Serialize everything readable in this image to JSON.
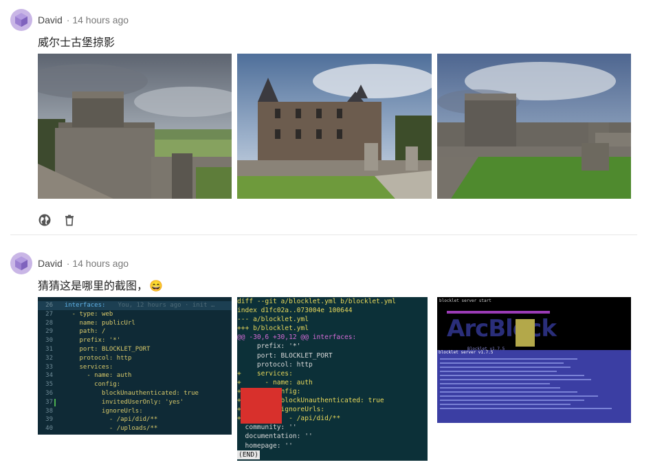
{
  "posts": [
    {
      "author": "David",
      "time": "· 14 hours ago",
      "text": "威尔士古堡掠影",
      "images": [
        {
          "alt": "castle-tower-photo"
        },
        {
          "alt": "chateau-photo"
        },
        {
          "alt": "castle-ruins-photo"
        }
      ],
      "actions": [
        {
          "icon": "globe-icon"
        },
        {
          "icon": "trash-icon"
        }
      ]
    },
    {
      "author": "David",
      "time": "· 14 hours ago",
      "text": "猜猜这是哪里的截图，",
      "emoji": "😄",
      "images": [
        {
          "alt": "code-editor-screenshot"
        },
        {
          "alt": "git-diff-screenshot"
        },
        {
          "alt": "terminal-blocklet-screenshot"
        }
      ]
    }
  ],
  "editor": {
    "lines": [
      {
        "no": "26",
        "text": "  interfaces:",
        "blame": "You, 12 hours ago · init …"
      },
      {
        "no": "27",
        "text": "    - type: web"
      },
      {
        "no": "28",
        "text": "      name: publicUrl"
      },
      {
        "no": "29",
        "text": "      path: /"
      },
      {
        "no": "30",
        "text": "      prefix: '*'"
      },
      {
        "no": "31",
        "text": "      port: BLOCKLET_PORT"
      },
      {
        "no": "32",
        "text": "      protocol: http"
      },
      {
        "no": "33",
        "text": "      services:"
      },
      {
        "no": "34",
        "text": "        - name: auth"
      },
      {
        "no": "35",
        "text": "          config:"
      },
      {
        "no": "36",
        "text": "            blockUnauthenticated: true"
      },
      {
        "no": "37",
        "text": "            invitedUserOnly: 'yes'"
      },
      {
        "no": "38",
        "text": "            ignoreUrls:"
      },
      {
        "no": "39",
        "text": "              - /api/did/**"
      },
      {
        "no": "40",
        "text": "              - /uploads/**"
      }
    ]
  },
  "diff": {
    "lines": [
      {
        "text": "diff --git a/blocklet.yml b/blocklet.yml",
        "color": "#e8d85a"
      },
      {
        "text": "index d1fc02a..073004e 100644",
        "color": "#e8d85a"
      },
      {
        "text": "--- a/blocklet.yml",
        "color": "#e8d85a"
      },
      {
        "text": "+++ b/blocklet.yml",
        "color": "#e8d85a"
      },
      {
        "text": "@@ -30,6 +30,12 @@ interfaces:",
        "color": "#d66bd6"
      },
      {
        "text": "     prefix: '*'",
        "color": "#d8d8d8"
      },
      {
        "text": "     port: BLOCKLET_PORT",
        "color": "#d8d8d8"
      },
      {
        "text": "     protocol: http",
        "color": "#d8d8d8"
      },
      {
        "text": "+    services:",
        "color": "#e8d85a"
      },
      {
        "text": "+      - name: auth",
        "color": "#e8d85a"
      },
      {
        "text": "+        config:",
        "color": "#e8d85a"
      },
      {
        "text": "+          blockUnauthenticated: true",
        "color": "#e8d85a"
      },
      {
        "text": "+          ignoreUrls:",
        "color": "#e8d85a"
      },
      {
        "text": "+            - /api/did/**",
        "color": "#e8d85a"
      },
      {
        "text": "  community: ''",
        "color": "#d8d8d8"
      },
      {
        "text": "  documentation: ''",
        "color": "#d8d8d8"
      },
      {
        "text": "  homepage: ''",
        "color": "#d8d8d8"
      },
      {
        "text": "(END)",
        "color": "#111111"
      }
    ]
  },
  "terminal": {
    "command": "blocklet server start",
    "version": "blocklet server v1.7.5",
    "logo_text": "ArcBlock",
    "logo_sub": "Blocklet v1.7.5"
  }
}
